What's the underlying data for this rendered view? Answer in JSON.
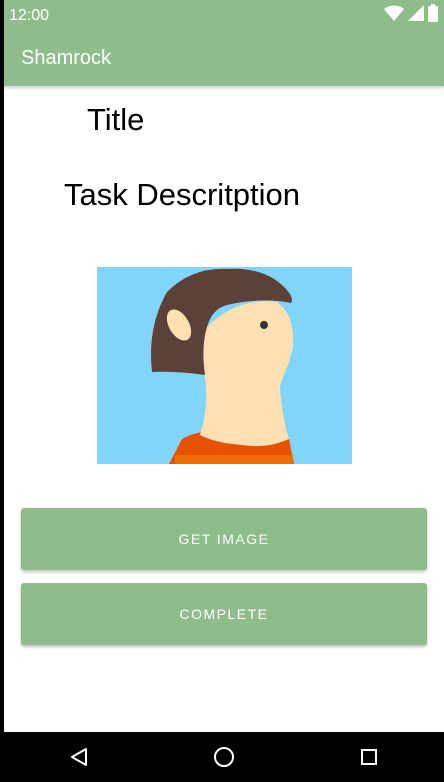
{
  "status_bar": {
    "time": "12:00",
    "icons": [
      "wifi-icon",
      "cell-signal-icon",
      "battery-icon"
    ]
  },
  "app_bar": {
    "title": "Shamrock"
  },
  "content": {
    "title": "Title",
    "description": "Task Descritption",
    "image_icon": "person-avatar-illustration"
  },
  "buttons": {
    "get_image": "GET IMAGE",
    "complete": "COMPLETE"
  },
  "nav_bar": {
    "icons": [
      "back-icon",
      "home-icon",
      "recent-apps-icon"
    ]
  },
  "colors": {
    "accent": "#8fbc8b",
    "image_background": "#81d4fa"
  }
}
